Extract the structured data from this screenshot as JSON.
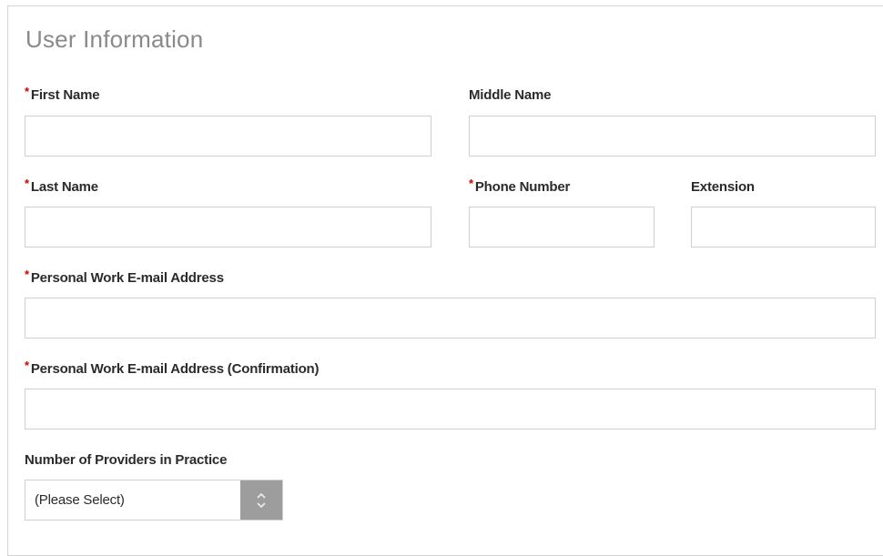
{
  "section": {
    "title": "User Information"
  },
  "required_marker": "*",
  "fields": {
    "first_name": {
      "label": "First Name",
      "value": "",
      "required": true
    },
    "middle_name": {
      "label": "Middle Name",
      "value": "",
      "required": false
    },
    "last_name": {
      "label": "Last Name",
      "value": "",
      "required": true
    },
    "phone_number": {
      "label": "Phone Number",
      "value": "",
      "required": true
    },
    "extension": {
      "label": "Extension",
      "value": "",
      "required": false
    },
    "email": {
      "label": "Personal Work E-mail Address",
      "value": "",
      "required": true
    },
    "email_confirm": {
      "label": "Personal Work E-mail Address (Confirmation)",
      "value": "",
      "required": true
    }
  },
  "providers": {
    "label": "Number of Providers in Practice",
    "selected": "(Please Select)",
    "arrow_icon": "up-down-chevron-icon"
  },
  "colors": {
    "required": "#d00000",
    "title": "#8a8a8a",
    "border": "#cfcfcf",
    "select_arrow_bg": "#9d9d9d"
  }
}
